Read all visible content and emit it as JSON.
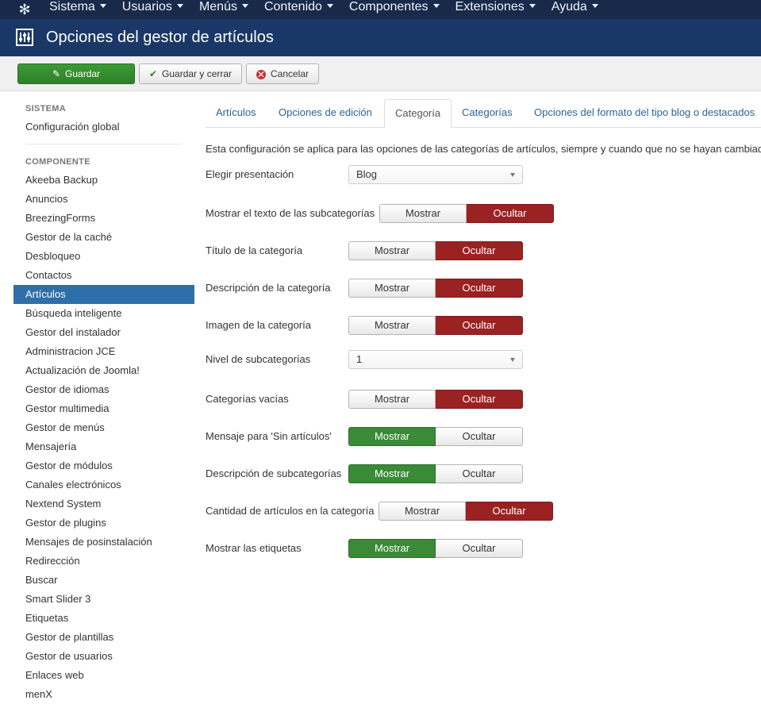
{
  "topnav": {
    "logo_icon": "joomla-icon",
    "menu": [
      "Sistema",
      "Usuarios",
      "Menús",
      "Contenido",
      "Componentes",
      "Extensiones",
      "Ayuda"
    ]
  },
  "header": {
    "icon": "sliders-icon",
    "title": "Opciones del gestor de artículos"
  },
  "toolbar": {
    "save_label": "Guardar",
    "save_close_label": "Guardar y cerrar",
    "cancel_label": "Cancelar"
  },
  "sidebar": {
    "system_heading": "SISTEMA",
    "global_config": "Configuración global",
    "component_heading": "COMPONENTE",
    "items": [
      "Akeeba Backup",
      "Anuncios",
      "BreezingForms",
      "Gestor de la caché",
      "Desbloqueo",
      "Contactos",
      "Artículos",
      "Búsqueda inteligente",
      "Gestor del instalador",
      "Administracion JCE",
      "Actualización de Joomla!",
      "Gestor de idiomas",
      "Gestor multimedia",
      "Gestor de menús",
      "Mensajería",
      "Gestor de módulos",
      "Canales electrónicos",
      "Nextend System",
      "Gestor de plugins",
      "Mensajes de posinstalación",
      "Redirección",
      "Buscar",
      "Smart Slider 3",
      "Etiquetas",
      "Gestor de plantillas",
      "Gestor de usuarios",
      "Enlaces web",
      "menX"
    ],
    "active_item": "Artículos"
  },
  "tabs": [
    "Artículos",
    "Opciones de edición",
    "Categoría",
    "Categorías",
    "Opciones del formato del tipo blog o destacados"
  ],
  "active_tab": "Categoría",
  "intro": "Esta configuración se aplica para las opciones de las categorías de artículos, siempre y cuando que no se hayan cambiado",
  "fields": [
    {
      "label": "Elegir presentación",
      "type": "select",
      "value": "Blog"
    },
    {
      "label": "Mostrar el texto de las subcategorías",
      "type": "toggle",
      "show": "Mostrar",
      "hide": "Ocultar",
      "selected": "Ocultar"
    },
    {
      "label": "Título de la categoría",
      "type": "toggle",
      "show": "Mostrar",
      "hide": "Ocultar",
      "selected": "Ocultar"
    },
    {
      "label": "Descripción de la categoría",
      "type": "toggle",
      "show": "Mostrar",
      "hide": "Ocultar",
      "selected": "Ocultar"
    },
    {
      "label": "Imagen de la categoría",
      "type": "toggle",
      "show": "Mostrar",
      "hide": "Ocultar",
      "selected": "Ocultar"
    },
    {
      "label": "Nivel de subcategorías",
      "type": "select",
      "value": "1"
    },
    {
      "label": "Categorías vacías",
      "type": "toggle",
      "show": "Mostrar",
      "hide": "Ocultar",
      "selected": "Ocultar"
    },
    {
      "label": "Mensaje para 'Sin artículos'",
      "type": "toggle",
      "show": "Mostrar",
      "hide": "Ocultar",
      "selected": "Mostrar"
    },
    {
      "label": "Descripción de subcategorías",
      "type": "toggle",
      "show": "Mostrar",
      "hide": "Ocultar",
      "selected": "Mostrar"
    },
    {
      "label": "Cantidad de artículos en la categoría",
      "type": "toggle",
      "show": "Mostrar",
      "hide": "Ocultar",
      "selected": "Ocultar"
    },
    {
      "label": "Mostrar las etiquetas",
      "type": "toggle",
      "show": "Mostrar",
      "hide": "Ocultar",
      "selected": "Mostrar"
    }
  ],
  "colors": {
    "topnav": "#18294a",
    "header": "#1a3867",
    "active_sidebar": "#2f6fa9",
    "hide_selected": "#9b2222",
    "show_selected": "#3a8a37"
  }
}
